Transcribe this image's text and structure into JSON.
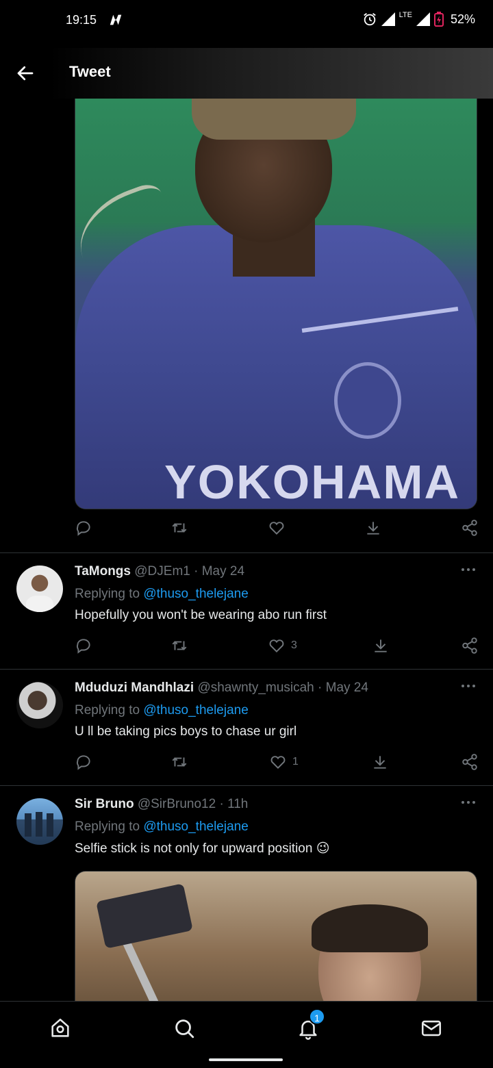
{
  "status_bar": {
    "time": "19:15",
    "network": "LTE",
    "battery": "52%"
  },
  "header": {
    "title": "Tweet"
  },
  "main_tweet": {
    "image_text": "YOKOHAMA",
    "actions": {
      "reply": "",
      "retweet": "",
      "like": "",
      "bookmark": "",
      "share": ""
    }
  },
  "replies": [
    {
      "name": "TaMongs",
      "handle": "@DJEm1",
      "date": "· May 24",
      "replying_prefix": "Replying to ",
      "replying_to": "@thuso_thelejane",
      "text": "Hopefully you won't be wearing abo run first",
      "like_count": "3"
    },
    {
      "name": "Mduduzi Mandhlazi",
      "handle": "@shawnty_musicah",
      "date": "· May 24",
      "replying_prefix": "Replying to ",
      "replying_to": "@thuso_thelejane",
      "text": "U ll be taking pics boys to chase ur girl",
      "like_count": "1"
    },
    {
      "name": "Sir Bruno",
      "handle": "@SirBruno12",
      "date": "· 11h",
      "replying_prefix": "Replying to ",
      "replying_to": "@thuso_thelejane",
      "text": "Selfie stick is not only for upward position",
      "emoji": "😉"
    }
  ],
  "bottom_nav": {
    "items": [
      "home-icon",
      "search-icon",
      "notifications-icon",
      "messages-icon"
    ],
    "notification_badge": "1"
  },
  "colors": {
    "background": "#000000",
    "accent": "#1d9bf0",
    "muted": "#71767b",
    "text": "#e7e9ea",
    "divider": "#2f3336"
  }
}
